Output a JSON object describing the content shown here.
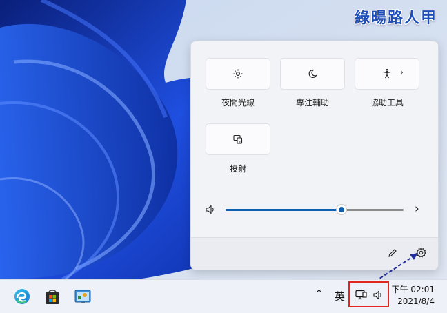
{
  "watermark": "綠暘路人甲",
  "quick_settings": {
    "tiles": [
      {
        "label": "夜間光線",
        "icon": "night-light-icon"
      },
      {
        "label": "專注輔助",
        "icon": "focus-assist-icon"
      },
      {
        "label": "協助工具",
        "icon": "accessibility-icon",
        "chevron": "›"
      },
      {
        "label": "投射",
        "icon": "cast-icon"
      }
    ],
    "volume": {
      "icon": "speaker-icon",
      "level": 0.65,
      "more": "›"
    },
    "footer": {
      "edit_icon": "pencil-icon",
      "settings_icon": "gear-icon"
    }
  },
  "taskbar": {
    "apps": [
      "edge-icon",
      "store-icon",
      "control-panel-icon"
    ],
    "tray": {
      "overflow": "^",
      "ime": "英",
      "network_icon": "network-icon",
      "volume_icon": "speaker-icon"
    },
    "clock": {
      "time": "下午 02:01",
      "date": "2021/8/4"
    }
  },
  "colors": {
    "accent": "#0f5fb0",
    "highlight_box": "#e0261e",
    "annotation_arrow": "#1f2e9a"
  }
}
